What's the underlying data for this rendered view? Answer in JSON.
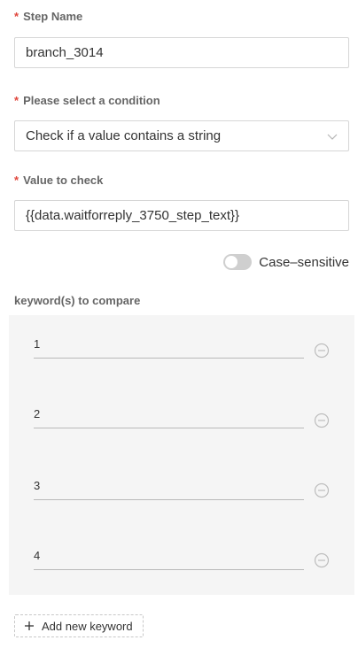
{
  "step_name": {
    "required_mark": "*",
    "label": "Step Name",
    "value": "branch_3014"
  },
  "condition": {
    "required_mark": "*",
    "label": "Please select a condition",
    "selected": "Check if a value contains a string",
    "icon": "chevron-down-icon"
  },
  "value_to_check": {
    "required_mark": "*",
    "label": "Value to check",
    "value": "{{data.waitforreply_3750_step_text}}"
  },
  "case_sensitive": {
    "label": "Case–sensitive",
    "enabled": false
  },
  "keywords": {
    "title": "keyword(s) to compare",
    "items": [
      {
        "value": "1"
      },
      {
        "value": "2"
      },
      {
        "value": "3"
      },
      {
        "value": "4"
      }
    ],
    "remove_icon": "minus-circle-icon",
    "add_label": "Add new keyword",
    "add_icon": "plus-icon"
  },
  "colors": {
    "required": "#e0463c",
    "label": "#666666",
    "border": "#d6d6d6",
    "panel": "#f5f5f5"
  }
}
